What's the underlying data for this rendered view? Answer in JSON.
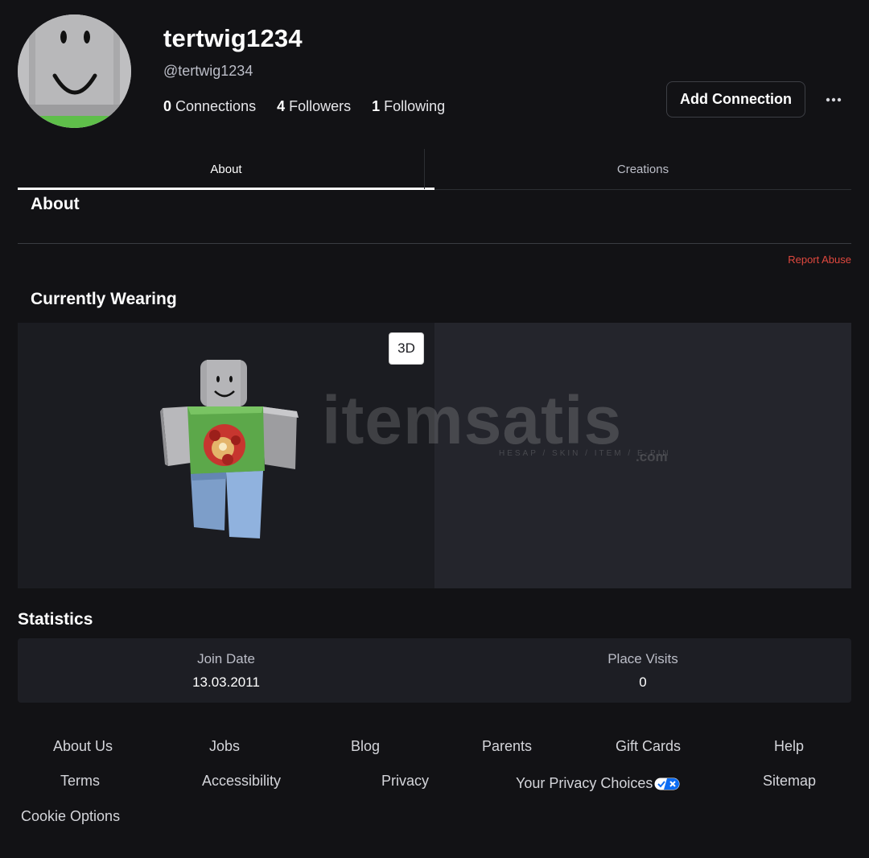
{
  "profile": {
    "display_name": "tertwig1234",
    "username": "@tertwig1234",
    "connections_count": "0",
    "connections_label": "Connections",
    "followers_count": "4",
    "followers_label": "Followers",
    "following_count": "1",
    "following_label": "Following"
  },
  "actions": {
    "add_connection": "Add Connection",
    "more_icon": "ellipsis-icon"
  },
  "tabs": [
    {
      "label": "About",
      "active": true
    },
    {
      "label": "Creations",
      "active": false
    }
  ],
  "about": {
    "heading": "About",
    "report_abuse": "Report Abuse"
  },
  "wearing": {
    "heading": "Currently Wearing",
    "toggle_3d": "3D"
  },
  "watermark": {
    "main": "itemsatis",
    "sub": "HESAP / SKIN / ITEM / E-PIN",
    "com": ".com"
  },
  "statistics": {
    "heading": "Statistics",
    "join_date_label": "Join Date",
    "join_date_value": "13.03.2011",
    "place_visits_label": "Place Visits",
    "place_visits_value": "0"
  },
  "footer": {
    "about_us": "About Us",
    "jobs": "Jobs",
    "blog": "Blog",
    "parents": "Parents",
    "gift_cards": "Gift Cards",
    "help": "Help",
    "terms": "Terms",
    "accessibility": "Accessibility",
    "privacy": "Privacy",
    "privacy_choices": "Your Privacy Choices",
    "sitemap": "Sitemap",
    "cookie_options": "Cookie Options"
  },
  "colors": {
    "background": "#121215",
    "panel": "#1b1c21",
    "report_abuse": "#e0483e",
    "privacy_toggle": "#0b6cf4"
  }
}
